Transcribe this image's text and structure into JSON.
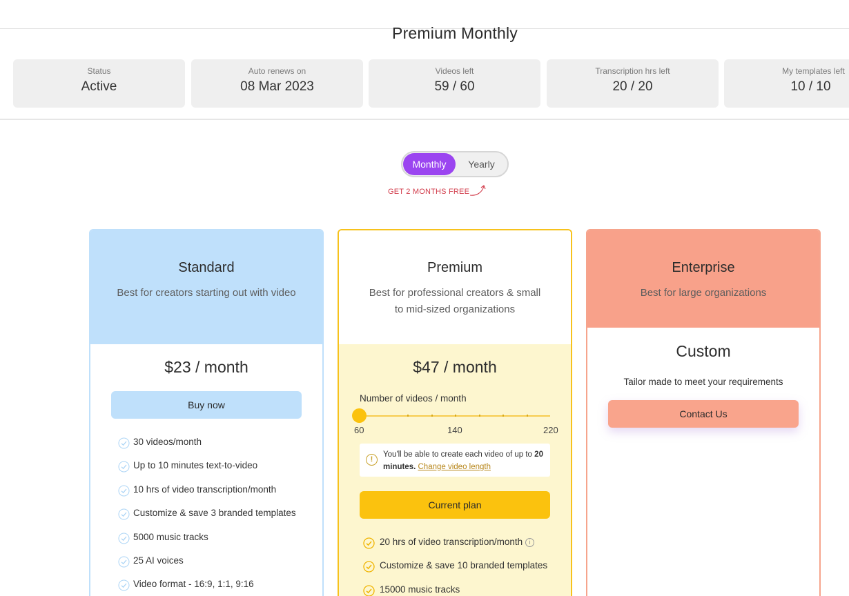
{
  "subscription": {
    "title": "Premium Monthly",
    "stats": [
      {
        "label": "Status",
        "value": "Active"
      },
      {
        "label": "Auto renews on",
        "value": "08 Mar 2023"
      },
      {
        "label": "Videos left",
        "value": "59 / 60"
      },
      {
        "label": "Transcription hrs left",
        "value": "20 / 20"
      },
      {
        "label": "My templates left",
        "value": "10 / 10"
      }
    ]
  },
  "billing_toggle": {
    "monthly": "Monthly",
    "yearly": "Yearly",
    "selected": "Monthly",
    "promo": "GET 2 MONTHS FREE"
  },
  "plans": {
    "standard": {
      "name": "Standard",
      "description": "Best for creators starting out with video",
      "price": "$23 / month",
      "button": "Buy now",
      "features": [
        "30 videos/month",
        "Up to 10 minutes text-to-video",
        "10 hrs of video transcription/month",
        "Customize & save 3 branded templates",
        "5000 music tracks",
        "25 AI voices",
        "Video format - 16:9, 1:1, 9:16"
      ]
    },
    "premium": {
      "name": "Premium",
      "description": "Best for professional creators & small to mid-sized organizations",
      "price": "$47 / month",
      "slider": {
        "label": "Number of videos / month",
        "min": "60",
        "mid": "140",
        "max": "220",
        "value": 60
      },
      "note": {
        "text": "You'll be able to create each video of up to",
        "bold": "20 minutes.",
        "link": "Change video length"
      },
      "button": "Current plan",
      "features": [
        "20 hrs of video transcription/month",
        "Customize & save 10 branded templates",
        "15000 music tracks"
      ]
    },
    "enterprise": {
      "name": "Enterprise",
      "description": "Best for large organizations",
      "price": "Custom",
      "subtext": "Tailor made to meet your requirements",
      "button": "Contact Us"
    }
  },
  "colors": {
    "accent_purple": "#9b45f0",
    "standard_blue": "#bfe0fb",
    "premium_yellow": "#fbc20e",
    "premium_bg": "#fdf6cf",
    "enterprise_salmon": "#f8a18a",
    "promo_red": "#d23c4b"
  }
}
